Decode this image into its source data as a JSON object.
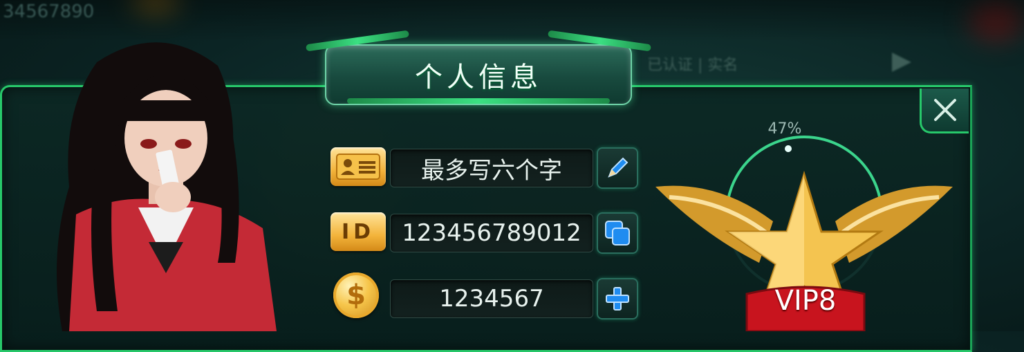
{
  "title": "个人信息",
  "top_bar": {
    "blurred_number": "34567890"
  },
  "side_text": "已认证 | 实名",
  "profile": {
    "name_label_icon": "id-card-icon",
    "name": "最多写六个字",
    "id_badge": "ID",
    "id": "123456789012",
    "coin_icon": "dollar-coin-icon",
    "coins": "1234567"
  },
  "actions": {
    "edit_icon": "pencil-icon",
    "copy_icon": "copy-icon",
    "add_icon": "plus-icon",
    "close_icon": "close-icon"
  },
  "vip": {
    "progress": 0.47,
    "progress_label": "47%",
    "level_label": "VIP8"
  },
  "colors": {
    "border_green": "#27c86a",
    "gold": "#f3b43b",
    "ribbon_red": "#c8141e",
    "blue_button": "#1f8cf0"
  }
}
